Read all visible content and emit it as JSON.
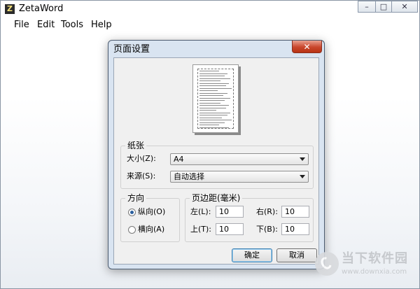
{
  "app": {
    "title": "ZetaWord",
    "icon_letter": "Z",
    "window_controls": [
      "–",
      "□",
      "✕"
    ]
  },
  "menu": [
    {
      "label": "File"
    },
    {
      "label": "Edit"
    },
    {
      "label": "Tools"
    },
    {
      "label": "Help"
    }
  ],
  "dialog": {
    "title": "页面设置",
    "close_glyph": "✕",
    "paper": {
      "legend": "纸张",
      "size_label": "大小(Z):",
      "size_value": "A4",
      "source_label": "来源(S):",
      "source_value": "自动选择"
    },
    "orientation": {
      "legend": "方向",
      "portrait_label": "纵向(O)",
      "landscape_label": "横向(A)",
      "selected": "portrait"
    },
    "margins": {
      "legend": "页边距(毫米)",
      "left_label": "左(L):",
      "left_value": "10",
      "right_label": "右(R):",
      "right_value": "10",
      "top_label": "上(T):",
      "top_value": "10",
      "bottom_label": "下(B):",
      "bottom_value": "10"
    },
    "ok_label": "确定",
    "cancel_label": "取消"
  },
  "watermark": {
    "text": "当下软件园",
    "url": "www.downxia.com"
  },
  "colors": {
    "dialog_frame": "#d9e4f1",
    "close_button": "#c9462c",
    "radio_selected": "#2a5f9e"
  }
}
